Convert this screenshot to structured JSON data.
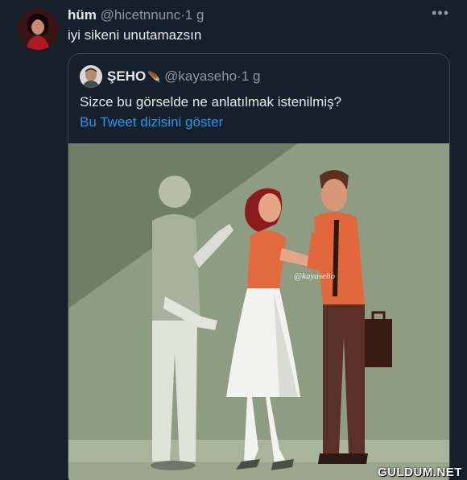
{
  "tweet": {
    "name": "hüm",
    "handle": "@hicetnnunc",
    "separator": "·",
    "time": "1 g",
    "more_icon": "more-horizontal-icon",
    "text": "iyi sikeni unutamazsın"
  },
  "quote": {
    "name": "ŞEHO",
    "badge": "🪶",
    "handle": "@kayaseho",
    "separator": "·",
    "time": "1 g",
    "text": "Sizce bu görselde ne anlatılmak istenilmiş?",
    "thread_link": "Bu Tweet dizisini göster",
    "image_watermark": "@kayaseho"
  },
  "site_watermark": "GULDUM.NET",
  "colors": {
    "background": "#15202b",
    "text": "#e7e9ea",
    "secondary": "#8b98a5",
    "link": "#1d9bf0",
    "border": "#38444d"
  }
}
